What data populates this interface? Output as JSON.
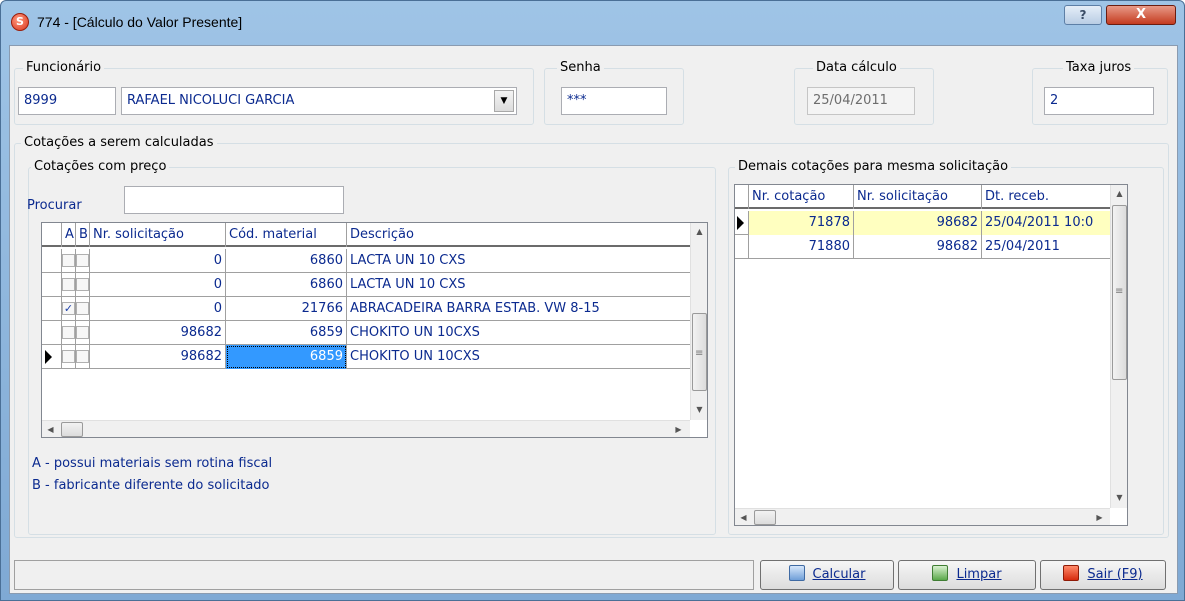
{
  "window": {
    "title": "774 - [Cálculo do Valor Presente]",
    "help_label": "?",
    "close_label": "X"
  },
  "funcionario": {
    "label": "Funcionário",
    "code": "8999",
    "name": "RAFAEL NICOLUCI GARCIA"
  },
  "senha": {
    "label": "Senha",
    "value": "***"
  },
  "data_calculo": {
    "label": "Data cálculo",
    "value": "25/04/2011"
  },
  "taxa_juros": {
    "label": "Taxa juros",
    "value": "2"
  },
  "cotacoes": {
    "outer_label": "Cotações a serem calculadas",
    "com_preco_label": "Cotações com preço",
    "procurar_label": "Procurar",
    "procurar_value": "",
    "columns": [
      "A",
      "B",
      "Nr. solicitação",
      "Cód. material",
      "Descrição"
    ],
    "rows": [
      {
        "a": false,
        "b": false,
        "nr_solicitacao": "0",
        "cod_material": "6860",
        "descricao": "LACTA UN 10 CXS"
      },
      {
        "a": false,
        "b": false,
        "nr_solicitacao": "0",
        "cod_material": "6860",
        "descricao": "LACTA UN 10 CXS"
      },
      {
        "a": true,
        "b": false,
        "nr_solicitacao": "0",
        "cod_material": "21766",
        "descricao": "ABRACADEIRA BARRA ESTAB. VW 8-15"
      },
      {
        "a": false,
        "b": false,
        "nr_solicitacao": "98682",
        "cod_material": "6859",
        "descricao": "CHOKITO UN 10CXS"
      },
      {
        "a": false,
        "b": false,
        "nr_solicitacao": "98682",
        "cod_material": "6859",
        "descricao": "CHOKITO UN 10CXS"
      }
    ],
    "current_row": 5,
    "legend_a": "A - possui materiais sem rotina fiscal",
    "legend_b": "B - fabricante diferente do solicitado"
  },
  "demais": {
    "label": "Demais cotações para mesma solicitação",
    "columns": [
      "Nr. cotação",
      "Nr. solicitação",
      "Dt. receb."
    ],
    "rows": [
      {
        "nr_cotacao": "71878",
        "nr_solicitacao": "98682",
        "dt_receb": "25/04/2011 10:0"
      },
      {
        "nr_cotacao": "71880",
        "nr_solicitacao": "98682",
        "dt_receb": "25/04/2011"
      }
    ]
  },
  "buttons": {
    "calcular": {
      "label": "Calcular",
      "icon": "calculator-icon"
    },
    "limpar": {
      "label": "Limpar",
      "icon": "eraser-icon"
    },
    "sair": {
      "label": "Sair (F9)",
      "icon": "exit-icon"
    }
  },
  "colors": {
    "text_blue": "#0b2a8f",
    "selection": "#3399ff",
    "highlight_row": "#ffffc0"
  }
}
